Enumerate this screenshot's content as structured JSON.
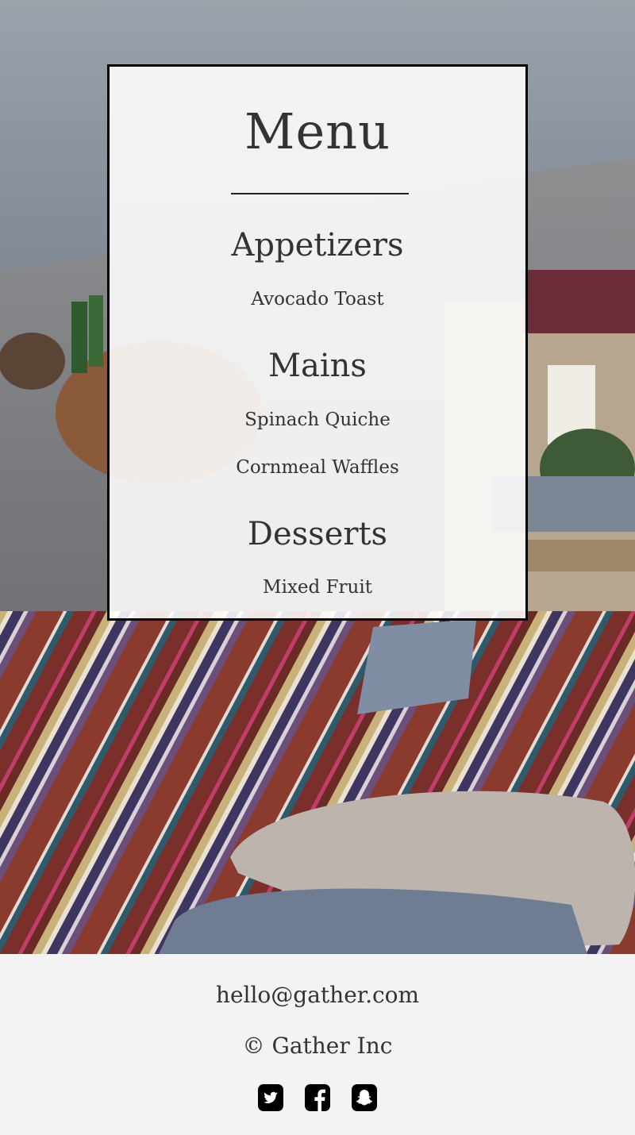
{
  "menu": {
    "title": "Menu",
    "sections": [
      {
        "heading": "Appetizers",
        "items": [
          "Avocado Toast"
        ]
      },
      {
        "heading": "Mains",
        "items": [
          "Spinach Quiche",
          "Cornmeal Waffles"
        ]
      },
      {
        "heading": "Desserts",
        "items": [
          "Mixed Fruit"
        ]
      }
    ]
  },
  "footer": {
    "email": "hello@gather.com",
    "copyright": "© Gather Inc",
    "social_icons": [
      "twitter-icon",
      "facebook-icon",
      "snapchat-icon"
    ]
  },
  "colors": {
    "card_border": "#000000",
    "text": "#333333",
    "footer_background": "#f3f3f3"
  }
}
